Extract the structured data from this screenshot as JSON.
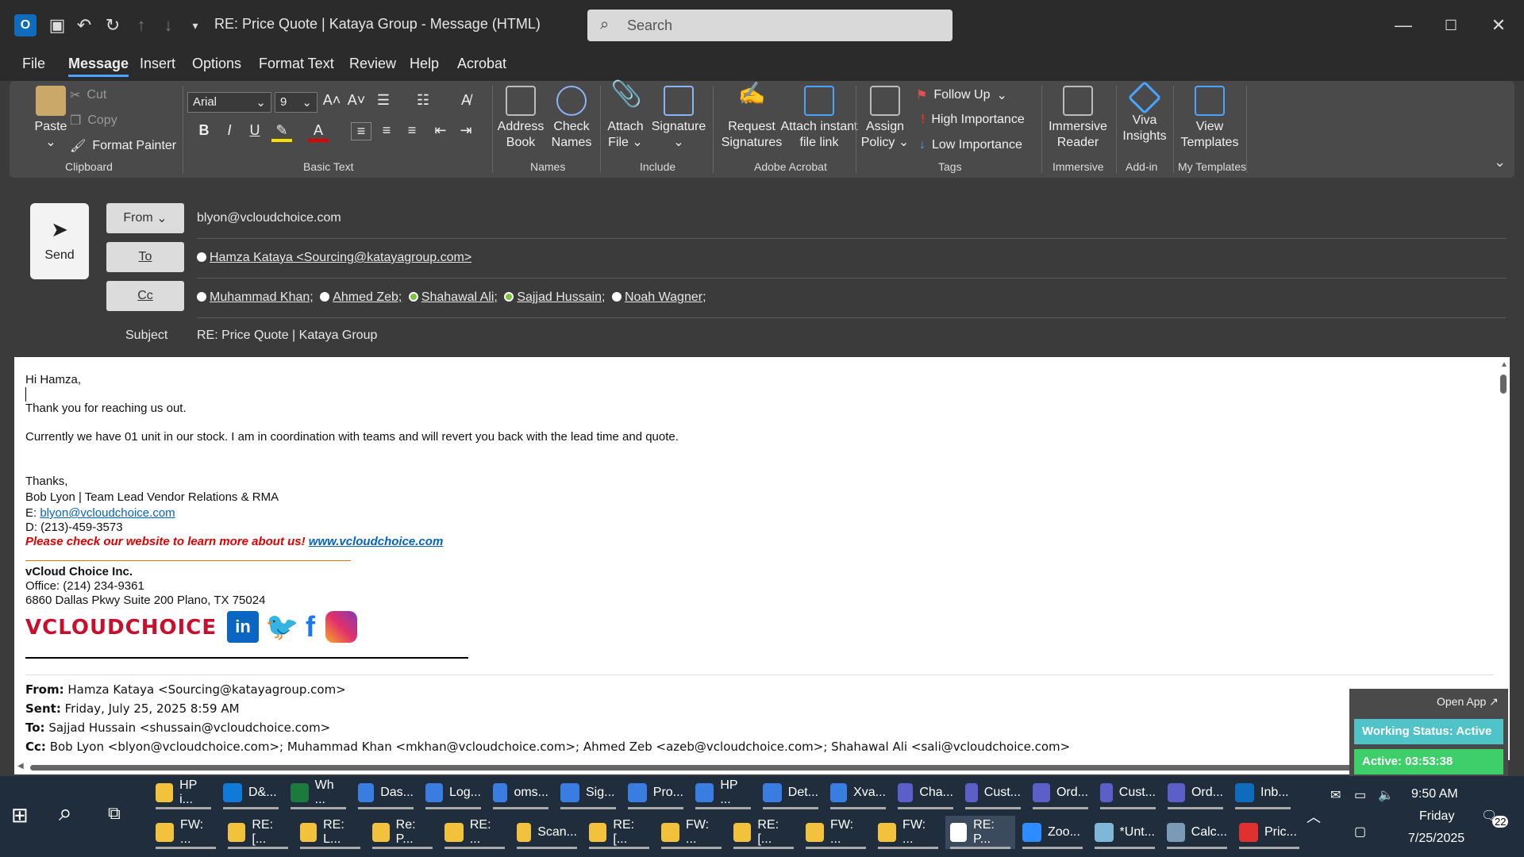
{
  "titlebar": {
    "title": "RE: Price Quote | Kataya Group  -  Message (HTML)",
    "search_placeholder": "Search"
  },
  "menu": [
    "File",
    "Message",
    "Insert",
    "Options",
    "Format Text",
    "Review",
    "Help",
    "Acrobat"
  ],
  "ribbon": {
    "clipboard": {
      "paste": "Paste",
      "cut": "Cut",
      "copy": "Copy",
      "format_painter": "Format Painter",
      "label": "Clipboard"
    },
    "basic_text": {
      "font": "Arial",
      "size": "9",
      "label": "Basic Text"
    },
    "names": {
      "address_book_1": "Address",
      "address_book_2": "Book",
      "check_names_1": "Check",
      "check_names_2": "Names",
      "label": "Names"
    },
    "include": {
      "attach_1": "Attach",
      "attach_2": "File",
      "signature": "Signature",
      "label": "Include"
    },
    "adobe": {
      "request_1": "Request",
      "request_2": "Signatures",
      "attach_link_1": "Attach instant",
      "attach_link_2": "file link",
      "label": "Adobe Acrobat"
    },
    "tags": {
      "assign_1": "Assign",
      "assign_2": "Policy",
      "follow_up": "Follow Up",
      "high": "High Importance",
      "low": "Low Importance",
      "label": "Tags"
    },
    "immersive": {
      "reader_1": "Immersive",
      "reader_2": "Reader",
      "label": "Immersive"
    },
    "addin": {
      "viva_1": "Viva",
      "viva_2": "Insights",
      "label": "Add-in"
    },
    "templates": {
      "view_1": "View",
      "view_2": "Templates",
      "label": "My Templates"
    }
  },
  "header": {
    "send": "Send",
    "from_label": "From",
    "from_value": "blyon@vcloudchoice.com",
    "to_label": "To",
    "to": [
      "Hamza Kataya <Sourcing@katayagroup.com>"
    ],
    "cc_label": "Cc",
    "cc": [
      "Muhammad Khan;",
      "Ahmed Zeb;",
      "Shahawal Ali;",
      "Sajjad Hussain;",
      "Noah Wagner;"
    ],
    "subject_label": "Subject",
    "subject": "RE: Price Quote | Kataya Group"
  },
  "body": {
    "greeting": "Hi Hamza,",
    "line1": "Thank you for reaching us out.",
    "line2": "Currently we have 01 unit in our stock. I am in coordination with teams and will revert you back with the lead time and quote.",
    "thanks": "Thanks,",
    "sig_name": "Bob Lyon | Team Lead Vendor Relations & RMA",
    "sig_email_prefix": "E: ",
    "sig_email": "blyon@vcloudchoice.com",
    "sig_phone": "D: (213)-459-3573",
    "promo": "Please check our website to learn more about us!",
    "website": "www.vcloudchoice.com",
    "company": "vCloud Choice Inc.",
    "office": "Office: (214) 234-9361",
    "address": "6860 Dallas Pkwy Suite 200 Plano, TX 75024",
    "logo_text": "VCLOUDCHOICE",
    "quoted": {
      "from_label": "From:",
      "from": "Hamza Kataya <Sourcing@katayagroup.com>",
      "sent_label": "Sent:",
      "sent": "Friday, July 25, 2025 8:59 AM",
      "to_label": "To:",
      "to": "Sajjad Hussain <shussain@vcloudchoice.com>",
      "cc_label": "Cc:",
      "cc": "Bob Lyon <blyon@vcloudchoice.com>; Muhammad Khan <mkhan@vcloudchoice.com>; Ahmed Zeb <azeb@vcloudchoice.com>; Shahawal Ali <sali@vcloudchoice.com>"
    }
  },
  "widget": {
    "open_app": "Open App ↗",
    "status": "Working Status: Active",
    "active": "Active: 03:53:38"
  },
  "taskbar": {
    "row1": [
      "HP i...",
      "D&...",
      "Wh ...",
      "Das...",
      "Log...",
      "oms...",
      "Sig...",
      "Pro...",
      "HP ...",
      "Det...",
      "Xva...",
      "Cha...",
      "Cust...",
      "Ord...",
      "Cust...",
      "Ord...",
      "Inb..."
    ],
    "row2": [
      "FW: ...",
      "RE: [...",
      "RE: L...",
      "Re: P...",
      "RE: ...",
      "Scan...",
      "RE: [...",
      "FW: ...",
      "RE: [...",
      "FW: ...",
      "FW: ...",
      "RE: P...",
      "Zoo...",
      "*Unt...",
      "Calc...",
      "Pric..."
    ],
    "time": "9:50 AM",
    "day": "Friday",
    "date": "7/25/2025",
    "notifications": "22"
  }
}
